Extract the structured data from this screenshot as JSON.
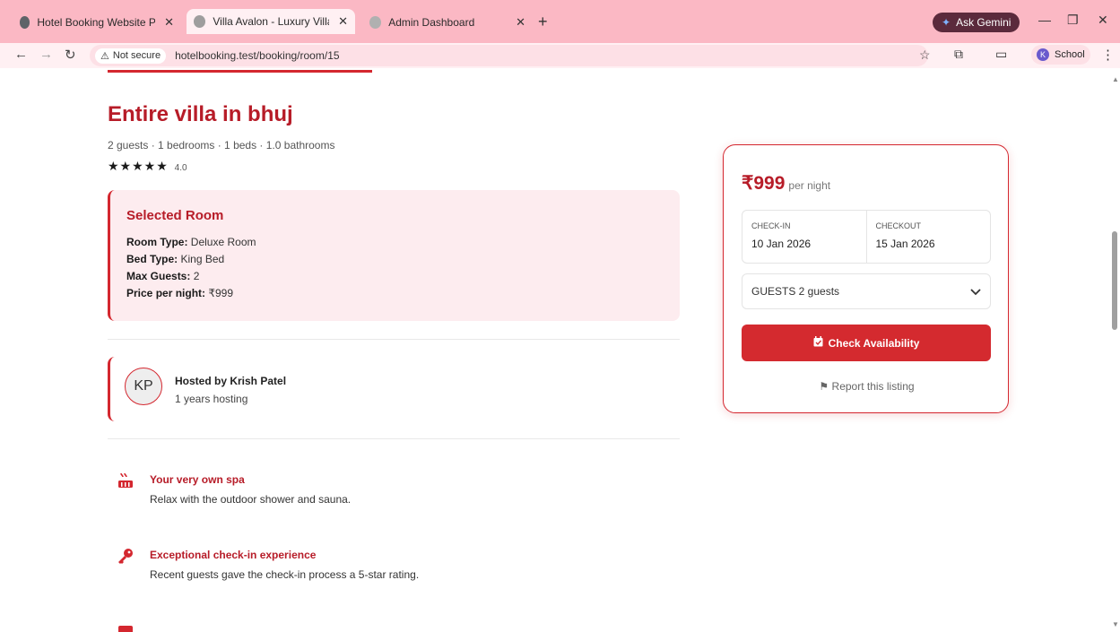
{
  "browser": {
    "tabs": [
      {
        "title": "Hotel Booking Website Project",
        "active": false
      },
      {
        "title": "Villa Avalon - Luxury Villa in Fet",
        "active": true
      },
      {
        "title": "Admin Dashboard",
        "active": false
      }
    ],
    "new_tab": "+",
    "ask_gemini": "Ask Gemini",
    "not_secure": "Not secure",
    "url": "hotelbooking.test/booking/room/15",
    "profile": "School",
    "profile_initial": "K"
  },
  "listing": {
    "title": "Entire villa in bhuj",
    "meta": "2 guests · 1 bedrooms · 1 beds · 1.0 bathrooms",
    "stars": "★★★★★",
    "rating": "4.0"
  },
  "selected_room": {
    "heading": "Selected Room",
    "room_type_label": "Room Type:",
    "room_type": "Deluxe Room",
    "bed_type_label": "Bed Type:",
    "bed_type": "King Bed",
    "max_guests_label": "Max Guests:",
    "max_guests": "2",
    "price_label": "Price per night:",
    "price": "₹999"
  },
  "host": {
    "initials": "KP",
    "name": "Hosted by Krish Patel",
    "years": "1 years hosting"
  },
  "features": [
    {
      "icon": "hot-tub-icon",
      "title": "Your very own spa",
      "desc": "Relax with the outdoor shower and sauna."
    },
    {
      "icon": "key-icon",
      "title": "Exceptional check-in experience",
      "desc": "Recent guests gave the check-in process a 5-star rating."
    }
  ],
  "booking": {
    "price": "₹999",
    "per_night": "per night",
    "checkin_label": "CHECK-IN",
    "checkin": "10 Jan 2026",
    "checkout_label": "CHECKOUT",
    "checkout": "15 Jan 2026",
    "guests": "GUESTS 2 guests",
    "button": "Check Availability",
    "report": "Report this listing"
  },
  "colors": {
    "accent": "#d4272f",
    "heading": "#b71c28",
    "tab_strip": "#fbb8c4"
  }
}
